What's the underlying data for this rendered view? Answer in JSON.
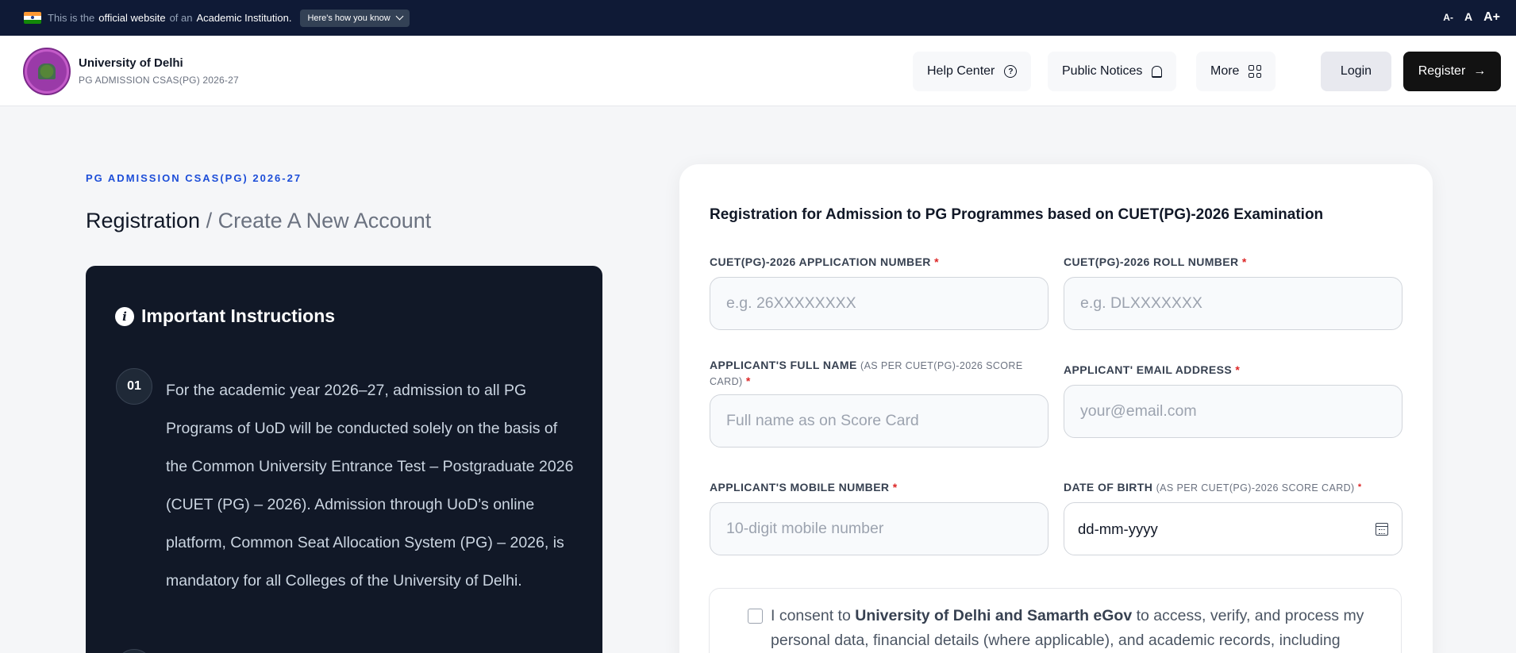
{
  "gov_bar": {
    "prefix": "This is the",
    "official": "official website",
    "of_an": "of an",
    "institution": "Academic Institution.",
    "how_button": "Here's how you know",
    "font_small": "A-",
    "font_normal": "A",
    "font_large": "A+"
  },
  "header": {
    "brand_name": "University of Delhi",
    "brand_sub": "PG ADMISSION CSAS(PG) 2026-27",
    "nav": {
      "help": "Help Center",
      "notices": "Public Notices",
      "more": "More"
    },
    "login": "Login",
    "register": "Register",
    "register_arrow": "→"
  },
  "left": {
    "eyebrow": "PG ADMISSION CSAS(PG) 2026-27",
    "title_main": "Registration",
    "title_sep": "/ Create A New Account",
    "instructions": {
      "heading": "Important Instructions",
      "info_glyph": "i",
      "steps": [
        {
          "num": "01",
          "text": "For the academic year 2026–27, admission to all PG Programs of UoD will be conducted solely on the basis of the Common University Entrance Test – Postgraduate 2026 (CUET (PG) – 2026). Admission through UoD’s online platform, Common Seat Allocation System (PG) – 2026, is mandatory for all Colleges of the University of Delhi."
        }
      ]
    }
  },
  "form": {
    "title": "Registration for Admission to PG Programmes based on CUET(PG)-2026 Examination",
    "required_mark": "*",
    "fields": {
      "app_number": {
        "label": "CUET(PG)-2026 APPLICATION NUMBER",
        "placeholder": "e.g. 26XXXXXXXX",
        "value": ""
      },
      "roll_number": {
        "label": "CUET(PG)-2026 ROLL NUMBER",
        "placeholder": "e.g. DLXXXXXXX",
        "value": ""
      },
      "full_name": {
        "label": "APPLICANT'S FULL NAME",
        "note": "(AS PER CUET(PG)-2026 SCORE CARD)",
        "placeholder": "Full name as on Score Card",
        "value": ""
      },
      "email": {
        "label": "APPLICANT' EMAIL ADDRESS",
        "placeholder": "your@email.com",
        "value": ""
      },
      "mobile": {
        "label": "APPLICANT'S MOBILE NUMBER",
        "placeholder": "10-digit mobile number",
        "value": ""
      },
      "dob": {
        "label": "DATE OF BIRTH",
        "note": "(AS PER CUET(PG)-2026 SCORE CARD)",
        "display": "dd-mm-yyyy"
      }
    },
    "consent": {
      "checked": false,
      "prefix": "I consent to",
      "org": "University of Delhi and Samarth eGov",
      "suffix": "to access, verify, and process my personal data, financial details (where applicable), and academic records, including"
    }
  }
}
